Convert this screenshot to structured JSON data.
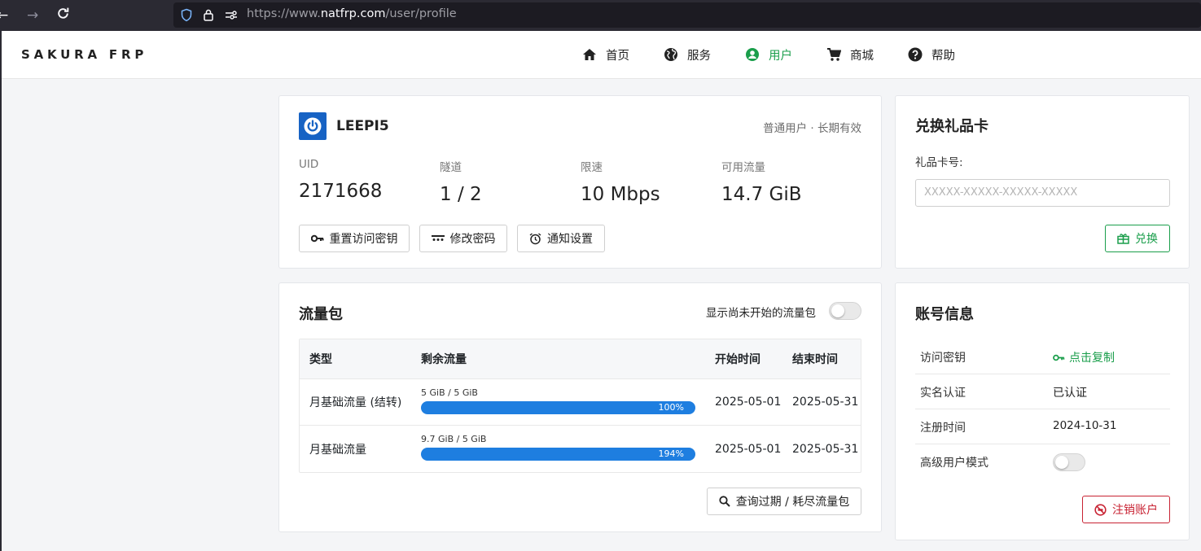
{
  "browser": {
    "url_prefix": "https://www.",
    "url_domain": "natfrp.com",
    "url_path": "/user/profile"
  },
  "header": {
    "brand": "SAKURA FRP",
    "nav": [
      {
        "label": "首页",
        "icon": "home-icon"
      },
      {
        "label": "服务",
        "icon": "globe-icon"
      },
      {
        "label": "用户",
        "icon": "user-circle-icon",
        "active": true
      },
      {
        "label": "商城",
        "icon": "cart-icon"
      },
      {
        "label": "帮助",
        "icon": "help-icon"
      }
    ]
  },
  "profile": {
    "username": "LEEPI5",
    "tag": "普通用户 · 长期有效",
    "stats": [
      {
        "label": "UID",
        "value": "2171668"
      },
      {
        "label": "隧道",
        "value": "1 / 2"
      },
      {
        "label": "限速",
        "value": "10 Mbps"
      },
      {
        "label": "可用流量",
        "value": "14.7 GiB"
      }
    ],
    "buttons": {
      "reset_key": "重置访问密钥",
      "change_password": "修改密码",
      "notify": "通知设置"
    }
  },
  "gift": {
    "title": "兑换礼品卡",
    "field_label": "礼品卡号:",
    "placeholder": "XXXXX-XXXXX-XXXXX-XXXXX",
    "redeem": "兑换"
  },
  "traffic": {
    "title": "流量包",
    "toggle_label": "显示尚未开始的流量包",
    "toggle_on": false,
    "columns": [
      "类型",
      "剩余流量",
      "开始时间",
      "结束时间"
    ],
    "rows": [
      {
        "type": "月基础流量 (结转)",
        "caption": "5 GiB / 5 GiB",
        "percent": "100%",
        "fill": 1.0,
        "start": "2025-05-01",
        "end": "2025-05-31"
      },
      {
        "type": "月基础流量",
        "caption": "9.7 GiB / 5 GiB",
        "percent": "194%",
        "fill": 1.0,
        "start": "2025-05-01",
        "end": "2025-05-31"
      }
    ],
    "query_button": "查询过期 / 耗尽流量包"
  },
  "account": {
    "title": "账号信息",
    "rows": [
      {
        "key": "访问密钥",
        "value": "点击复制"
      },
      {
        "key": "实名认证",
        "value": "已认证"
      },
      {
        "key": "注册时间",
        "value": "2024-10-31"
      },
      {
        "key": "高级用户模式",
        "value": ""
      }
    ],
    "advanced_mode_on": false,
    "delete_button": "注销账户"
  },
  "colors": {
    "accent_green": "#1a9e4b",
    "progress_blue": "#1e7ee0",
    "danger_red": "#c82333",
    "avatar_blue": "#1763c4"
  }
}
